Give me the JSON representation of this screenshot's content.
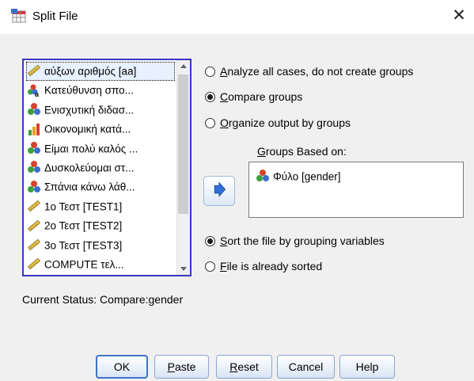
{
  "window": {
    "title": "Split File",
    "close_glyph": "✕"
  },
  "variable_list": {
    "items": [
      {
        "label": "αύξων αριθμός [aa]",
        "icon": "scale-ruler-icon",
        "selected": true
      },
      {
        "label": "Κατεύθυνση σπο...",
        "icon": "nominal-string-icon"
      },
      {
        "label": "Ενισχυτική διδασ...",
        "icon": "nominal-icon"
      },
      {
        "label": "Οικονομική κατά...",
        "icon": "ordinal-icon"
      },
      {
        "label": "Είμαι πολύ καλός ...",
        "icon": "nominal-icon"
      },
      {
        "label": "Δυσκολεύομαι στ...",
        "icon": "nominal-icon"
      },
      {
        "label": "Σπάνια κάνω λάθ...",
        "icon": "nominal-icon"
      },
      {
        "label": "1ο Τεστ [TEST1]",
        "icon": "scale-ruler-icon"
      },
      {
        "label": "2ο Τεστ [TEST2]",
        "icon": "scale-ruler-icon"
      },
      {
        "label": "3ο Τεστ [TEST3]",
        "icon": "scale-ruler-icon"
      },
      {
        "label": "COMPUTE τελ...",
        "icon": "scale-ruler-icon"
      }
    ]
  },
  "options": {
    "analyze_all": {
      "prefix": "",
      "accel": "A",
      "rest": "nalyze all cases, do not create groups",
      "checked": false
    },
    "compare_groups": {
      "prefix": "",
      "accel": "C",
      "rest": "ompare groups",
      "checked": true
    },
    "organize_output": {
      "prefix": "",
      "accel": "O",
      "rest": "rganize output by groups",
      "checked": false
    }
  },
  "groups": {
    "label_prefix": "",
    "label_accel": "G",
    "label_rest": "roups Based on:",
    "items": [
      {
        "label": "Φύλο [gender]",
        "icon": "nominal-icon"
      }
    ]
  },
  "sort_options": {
    "sort_file": {
      "prefix": "",
      "accel": "S",
      "rest": "ort the file by grouping variables",
      "checked": true
    },
    "already_sorted": {
      "prefix": "",
      "accel": "F",
      "rest": "ile is already sorted",
      "checked": false
    }
  },
  "status": {
    "text": "Current Status: Compare:gender"
  },
  "buttons": {
    "ok": {
      "prefix": "OK",
      "accel": "",
      "rest": ""
    },
    "paste": {
      "prefix": "",
      "accel": "P",
      "rest": "aste"
    },
    "reset": {
      "prefix": "",
      "accel": "R",
      "rest": "eset"
    },
    "cancel": {
      "prefix": "Cancel",
      "accel": "",
      "rest": ""
    },
    "help": {
      "prefix": "Help",
      "accel": "",
      "rest": ""
    }
  },
  "colors": {
    "list_border": "#3a35c4",
    "move_arrow": "#2f6fd6",
    "dialog_bg": "#f0f0f0"
  }
}
